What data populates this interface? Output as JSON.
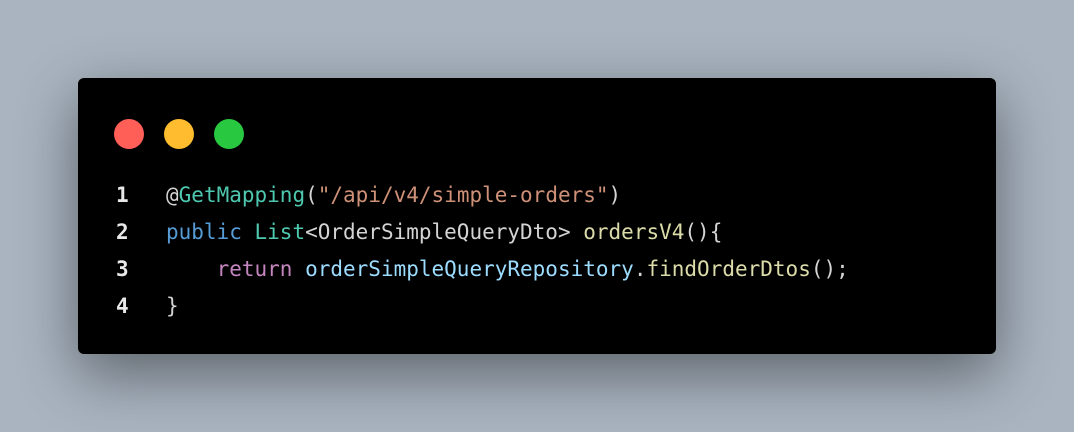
{
  "window_controls": [
    {
      "name": "close",
      "color": "#ff5f57"
    },
    {
      "name": "minimize",
      "color": "#febc2e"
    },
    {
      "name": "zoom",
      "color": "#28c840"
    }
  ],
  "lines": [
    {
      "number": "1",
      "tokens": [
        {
          "text": "@",
          "color": "#d4d4d4"
        },
        {
          "text": "GetMapping",
          "color": "#4ec9b0"
        },
        {
          "text": "(",
          "color": "#d4d4d4"
        },
        {
          "text": "\"/api/v4/simple-orders\"",
          "color": "#ce9178"
        },
        {
          "text": ")",
          "color": "#d4d4d4"
        }
      ]
    },
    {
      "number": "2",
      "tokens": [
        {
          "text": "public",
          "color": "#569cd6"
        },
        {
          "text": " ",
          "color": "#d4d4d4"
        },
        {
          "text": "List",
          "color": "#4ec9b0"
        },
        {
          "text": "<OrderSimpleQueryDto> ",
          "color": "#d4d4d4"
        },
        {
          "text": "ordersV4",
          "color": "#dcdcaa"
        },
        {
          "text": "(){",
          "color": "#d4d4d4"
        }
      ]
    },
    {
      "number": "3",
      "tokens": [
        {
          "text": "    ",
          "color": "#d4d4d4"
        },
        {
          "text": "return",
          "color": "#c586c0"
        },
        {
          "text": " ",
          "color": "#d4d4d4"
        },
        {
          "text": "orderSimpleQueryRepository",
          "color": "#9cdcfe"
        },
        {
          "text": ".",
          "color": "#d4d4d4"
        },
        {
          "text": "findOrderDtos",
          "color": "#dcdcaa"
        },
        {
          "text": "();",
          "color": "#d4d4d4"
        }
      ]
    },
    {
      "number": "4",
      "tokens": [
        {
          "text": "}",
          "color": "#d4d4d4"
        }
      ]
    }
  ]
}
